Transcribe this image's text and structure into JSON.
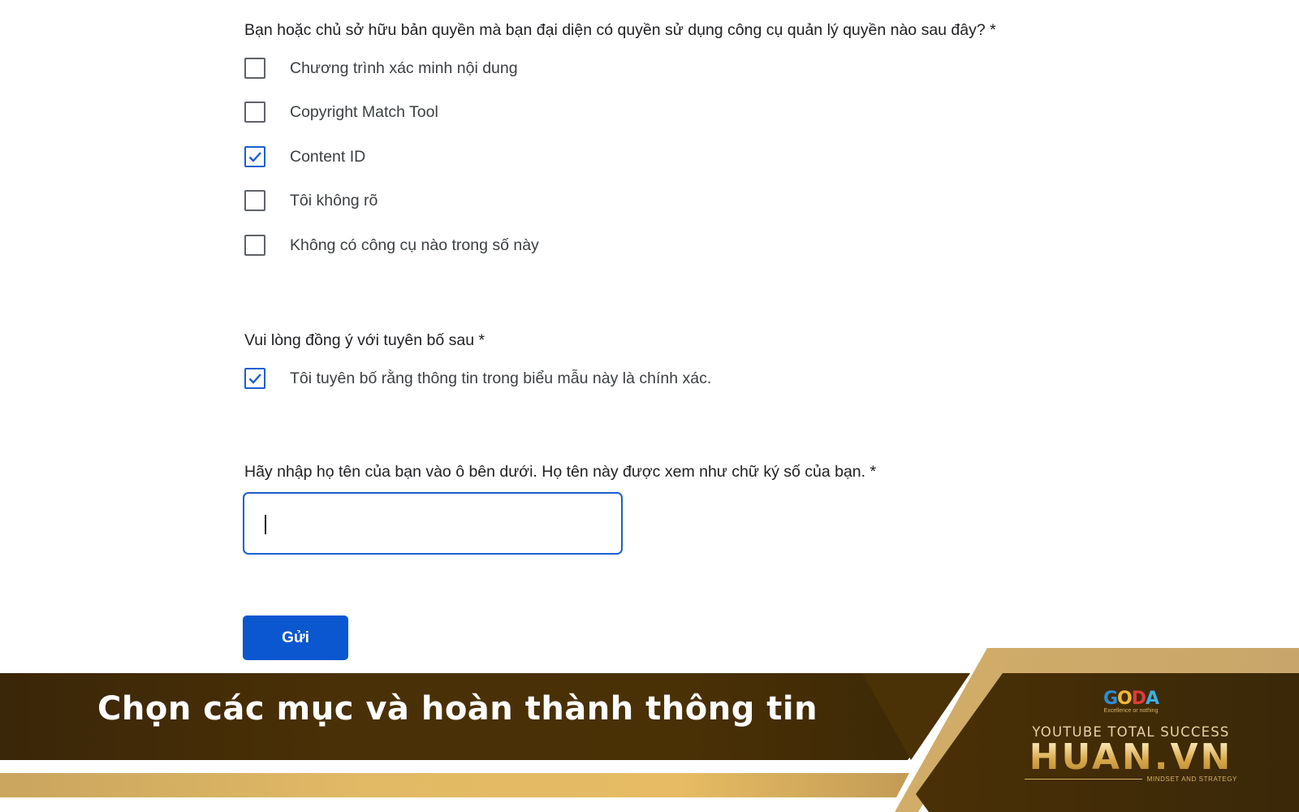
{
  "form": {
    "tools_question": {
      "label": "Bạn hoặc chủ sở hữu bản quyền mà bạn đại diện có quyền sử dụng công cụ quản lý quyền nào sau đây? *",
      "options": [
        {
          "label": "Chương trình xác minh nội dung",
          "checked": false
        },
        {
          "label": "Copyright Match Tool",
          "checked": false
        },
        {
          "label": "Content ID",
          "checked": true
        },
        {
          "label": "Tôi không rõ",
          "checked": false
        },
        {
          "label": "Không có công cụ nào trong số này",
          "checked": false
        }
      ]
    },
    "agreement": {
      "label": "Vui lòng đồng ý với tuyên bố sau *",
      "option": {
        "label": "Tôi tuyên bố rằng thông tin trong biểu mẫu này là chính xác.",
        "checked": true
      }
    },
    "signature": {
      "label": "Hãy nhập họ tên của bạn vào ô bên dưới. Họ tên này được xem như chữ ký số của bạn. *",
      "value": "",
      "placeholder": ""
    },
    "submit_label": "Gửi"
  },
  "banner": {
    "title": "Chọn các mục và hoàn thành thông tin",
    "brand": {
      "goda_letters": [
        "G",
        "O",
        "D",
        "A"
      ],
      "goda_colors": [
        "#2a8fd6",
        "#f2b632",
        "#e03b3b",
        "#3bb0e0"
      ],
      "goda_tagline": "Excellence or nothing",
      "line1": "YOUTUBE TOTAL SUCCESS",
      "name": "HUAN.VN",
      "tagline": "MINDSET AND STRATEGY"
    }
  },
  "colors": {
    "accent_blue": "#0b57d0",
    "checkbox_checked": "#1a5fd1",
    "banner_dark": "#3f2a08",
    "banner_gold": "#d9b062"
  }
}
